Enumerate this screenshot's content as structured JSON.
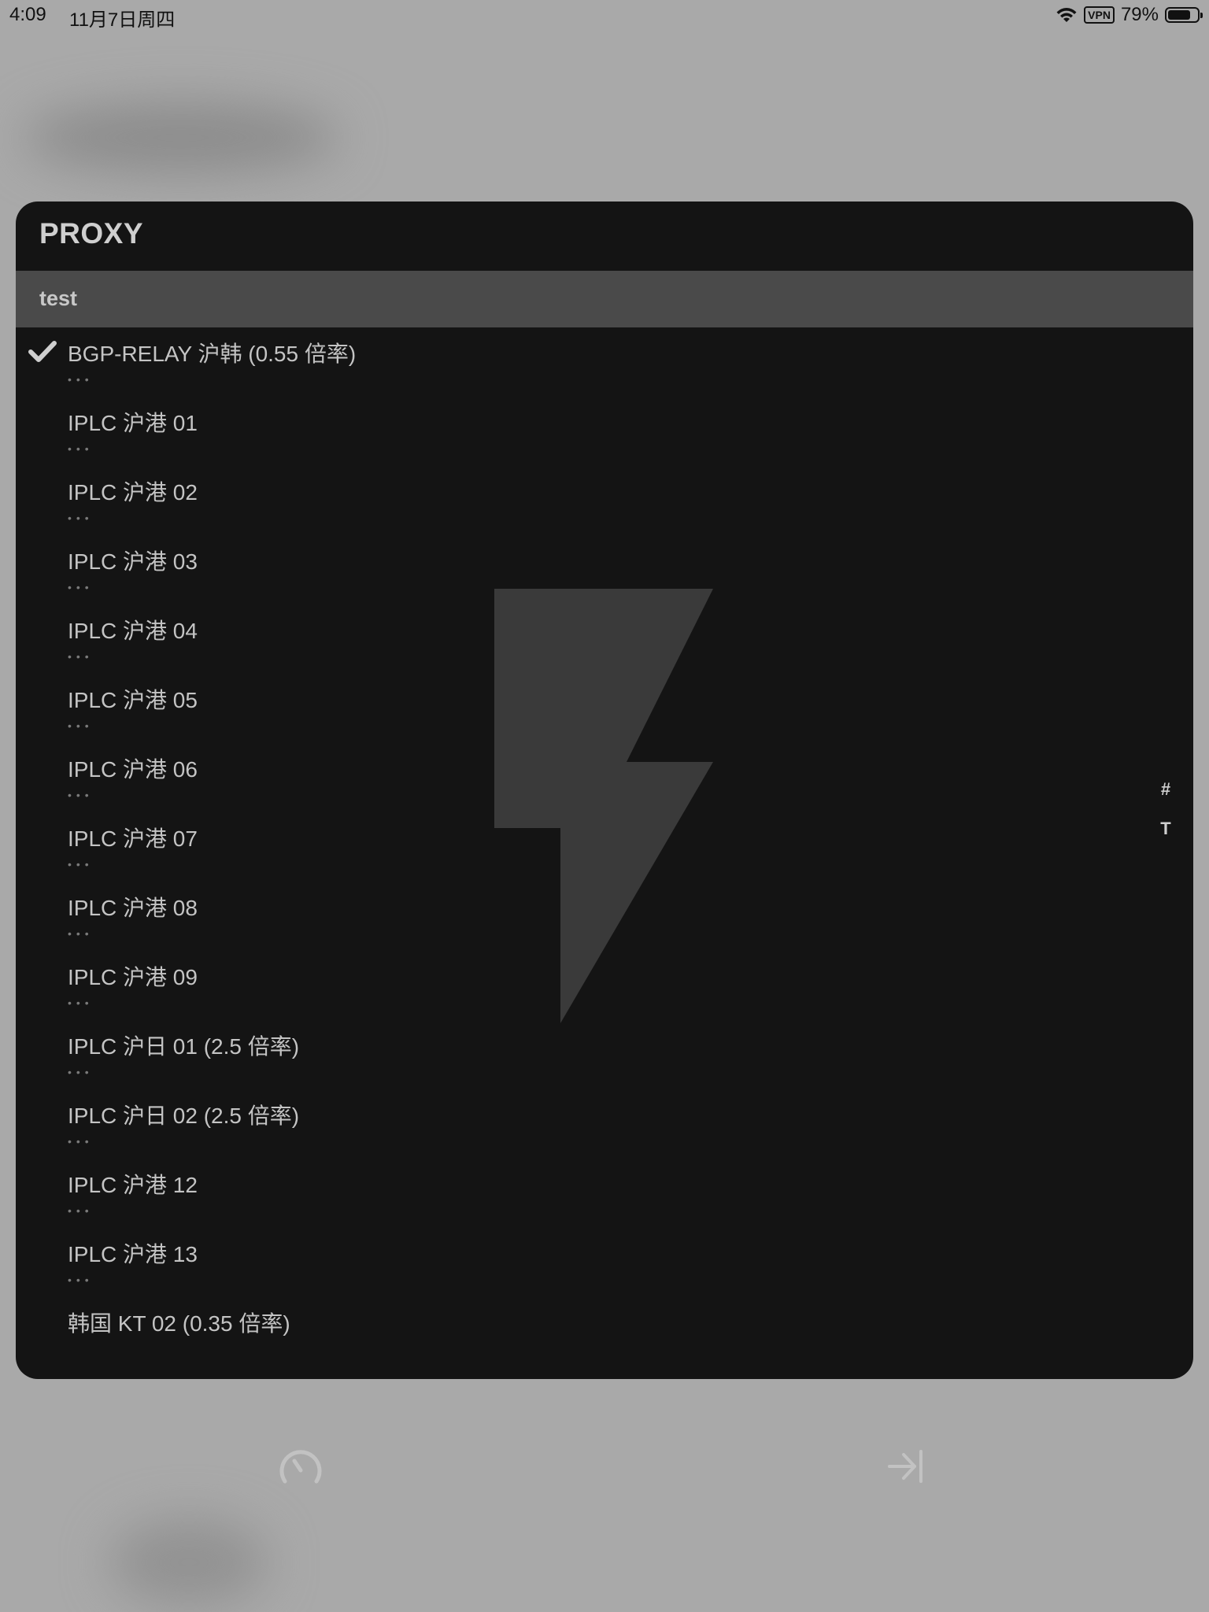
{
  "status_bar": {
    "time": "4:09",
    "date": "11月7日周四",
    "vpn": "VPN",
    "battery": "79%",
    "battery_level": 0.79
  },
  "panel": {
    "title": "PROXY",
    "group": "test"
  },
  "proxies": [
    {
      "name": "BGP-RELAY 沪韩 (0.55 倍率)",
      "selected": true,
      "dots": "•••"
    },
    {
      "name": "IPLC 沪港 01",
      "selected": false,
      "dots": "•••"
    },
    {
      "name": "IPLC 沪港 02",
      "selected": false,
      "dots": "•••"
    },
    {
      "name": "IPLC 沪港 03",
      "selected": false,
      "dots": "•••"
    },
    {
      "name": "IPLC 沪港 04",
      "selected": false,
      "dots": "•••"
    },
    {
      "name": "IPLC 沪港 05",
      "selected": false,
      "dots": "•••"
    },
    {
      "name": "IPLC 沪港 06",
      "selected": false,
      "dots": "•••"
    },
    {
      "name": "IPLC 沪港 07",
      "selected": false,
      "dots": "•••"
    },
    {
      "name": "IPLC 沪港 08",
      "selected": false,
      "dots": "•••"
    },
    {
      "name": "IPLC 沪港 09",
      "selected": false,
      "dots": "•••"
    },
    {
      "name": "IPLC 沪日 01 (2.5 倍率)",
      "selected": false,
      "dots": "•••"
    },
    {
      "name": "IPLC 沪日 02 (2.5 倍率)",
      "selected": false,
      "dots": "•••"
    },
    {
      "name": "IPLC 沪港 12",
      "selected": false,
      "dots": "•••"
    },
    {
      "name": "IPLC 沪港 13",
      "selected": false,
      "dots": "•••"
    },
    {
      "name": "韩国 KT 02 (0.35 倍率)",
      "selected": false,
      "dots": ""
    }
  ],
  "index_bar": [
    "#",
    "T"
  ],
  "bottom_icons": [
    "speedometer-icon",
    "collapse-to-end-icon"
  ]
}
